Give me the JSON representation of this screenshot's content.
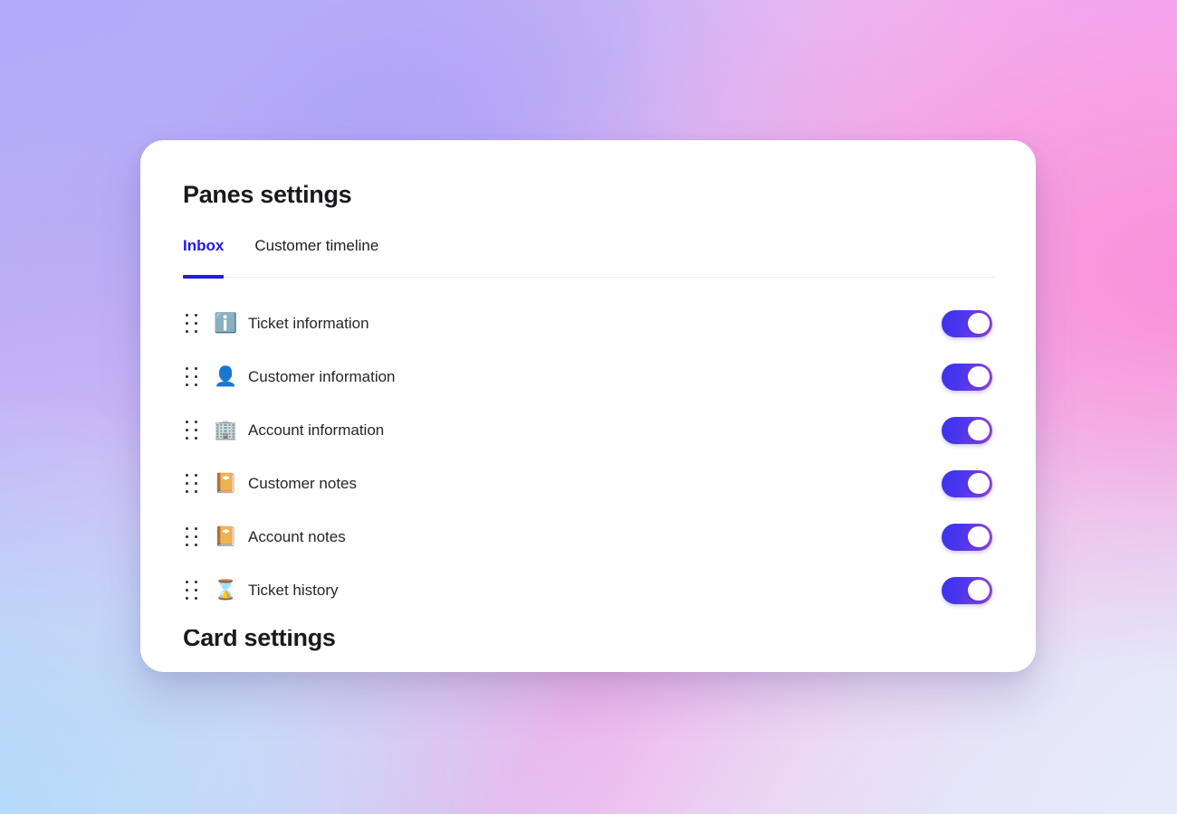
{
  "theme": {
    "accent_blue": "#2417f0",
    "toggle_gradient_start": "#3b33ea",
    "toggle_gradient_end": "#9a46dd",
    "card_background": "#ffffff",
    "text_primary": "#1a1a1e",
    "background_colors": [
      "#b7aaf7",
      "#f3a5f4",
      "#fa8cd8",
      "#b0dcfa",
      "#eef0fa"
    ]
  },
  "header": {
    "title": "Panes settings"
  },
  "tabs": [
    {
      "label": "Inbox",
      "active": true
    },
    {
      "label": "Customer timeline",
      "active": false
    }
  ],
  "panes": [
    {
      "icon": "information-icon",
      "emoji": "ℹ️",
      "label": "Ticket information",
      "enabled": true,
      "toggle_state": "on"
    },
    {
      "icon": "person-icon",
      "emoji": "👤",
      "label": "Customer information",
      "enabled": true,
      "toggle_state": "on"
    },
    {
      "icon": "office-building-icon",
      "emoji": "🏢",
      "label": "Account information",
      "enabled": true,
      "toggle_state": "on"
    },
    {
      "icon": "notebook-icon",
      "emoji": "📔",
      "label": "Customer notes",
      "enabled": true,
      "toggle_state": "on"
    },
    {
      "icon": "notebook-icon",
      "emoji": "📔",
      "label": "Account notes",
      "enabled": true,
      "toggle_state": "on"
    },
    {
      "icon": "hourglass-icon",
      "emoji": "⌛",
      "label": "Ticket history",
      "enabled": true,
      "toggle_state": "on"
    }
  ],
  "next_section": {
    "title": "Card settings"
  }
}
